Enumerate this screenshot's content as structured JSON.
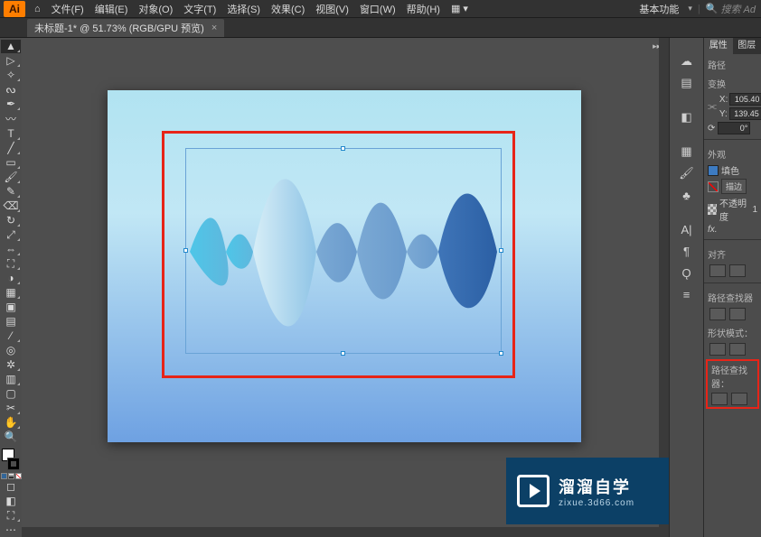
{
  "app_logo": "Ai",
  "menu": {
    "file": "文件(F)",
    "edit": "编辑(E)",
    "object": "对象(O)",
    "type": "文字(T)",
    "select": "选择(S)",
    "effect": "效果(C)",
    "view": "视图(V)",
    "window": "窗口(W)",
    "help": "帮助(H)"
  },
  "essentials_label": "基本功能",
  "search": {
    "placeholder": "搜索 Ad"
  },
  "document_tab": {
    "title": "未标题-1* @ 51.73% (RGB/GPU 预览)",
    "close": "×"
  },
  "panel_tabs": {
    "properties": "属性",
    "layers": "图层"
  },
  "sections": {
    "path": "路径",
    "transform": "变换",
    "appearance": "外观",
    "fill": "填色",
    "stroke": "描边",
    "opacity": "不透明度",
    "align": "对齐",
    "pathfinder": "路径查找器",
    "shape_modes": "形状模式：",
    "pathfinders_row": "路径查找器："
  },
  "transform": {
    "x_label": "X:",
    "y_label": "Y:",
    "x_value": "105.40",
    "y_value": "139.45",
    "angle_value": "0°",
    "angle_icon": "⟳"
  },
  "appearance": {
    "stroke_button": "描边",
    "opacity_value": "1",
    "fx_label": "fx."
  },
  "watermark": {
    "line1": "溜溜自学",
    "line2": "zixue.3d66.com"
  }
}
